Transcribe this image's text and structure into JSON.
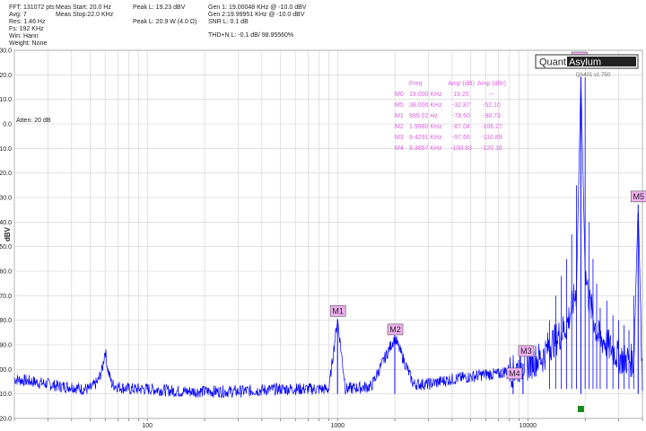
{
  "header": {
    "col1": [
      "FFT: 131072 pts",
      "Avg: 7",
      "Res: 1.46 Hz",
      "Fs: 192 KHz",
      "Win: Hann",
      "Weight: None"
    ],
    "col2": [
      "Meas Start: 20.0 Hz",
      "Meas Stop:22.0 KHz"
    ],
    "col3": [
      "Peak L: 19.23 dBV",
      "",
      "Peak L: 20.9 W (4.0 Ω)"
    ],
    "col4": [
      "Gen 1: 19.00048 KHz @ -10.0  dBV",
      "Gen 2:19.99951 KHz @ -10.0  dBV",
      "SNR L: 0.1 dB",
      "",
      "THD+N L: -0.1 dB/ 98.95560%"
    ]
  },
  "logo": {
    "part1": "Quant",
    "part2": "Asylum",
    "model": "QA401 v1.750"
  },
  "atten": "Atten: 20 dB",
  "marker_table": {
    "headers": [
      "Freq",
      "Amp (dB)",
      "Amp (dBr)"
    ],
    "rows": [
      [
        "M0",
        "19.000 KHz",
        "19.25",
        "---"
      ],
      [
        "M5",
        "38.000 KHz",
        "-32.87",
        "-52.10"
      ],
      [
        "M1",
        "999.02 Hz",
        "-79.50",
        "-98.73"
      ],
      [
        "M2",
        "1.9980 KHz",
        "-87.04",
        "-106.27"
      ],
      [
        "M3",
        "9.4291 KHz",
        "-97.66",
        "-116.89"
      ],
      [
        "M4",
        "8.3657 KHz",
        "-100.93",
        "-120.16"
      ]
    ]
  },
  "colors": {
    "trace": "#0000ff",
    "marker_fill": "#f0b0f0",
    "marker_text": "#e060e0",
    "gen_marker": "#1a8a1a",
    "grid": "#cfcfcf"
  },
  "chart_data": {
    "type": "line",
    "title": "",
    "xlabel": "",
    "ylabel": "dBV",
    "xscale": "log",
    "xlim": [
      20,
      40000
    ],
    "ylim": [
      -120,
      30
    ],
    "yticks": [
      30,
      20,
      10,
      0,
      -10,
      -20,
      -30,
      -40,
      -50,
      -60,
      -70,
      -80,
      -90,
      -100,
      -110,
      -120
    ],
    "ytick_labels": [
      "30.0",
      "20.0",
      "10.0",
      "0.0",
      "-10.0",
      "-20.0",
      "-30.0",
      "-40.0",
      "-50.0",
      "-60.0",
      "-70.0",
      "-80.0",
      "-90.0",
      "-100.0",
      "-110.0",
      "-120.0"
    ],
    "xticks": [
      100,
      1000,
      10000
    ],
    "xtick_labels": [
      "100",
      "1000",
      "10000"
    ],
    "grid": true,
    "series": [
      {
        "x": [
          20,
          25,
          30,
          35,
          40,
          45,
          50,
          55,
          58,
          60,
          62,
          65,
          70,
          80,
          100,
          150,
          200,
          300,
          500,
          700,
          900,
          999,
          1100,
          1500,
          1998,
          2500,
          3000,
          4000,
          5000,
          6000,
          7000,
          8000,
          8366,
          9000,
          9429,
          10000,
          11000,
          12000,
          13000,
          14000,
          15000,
          16000,
          17000,
          18000,
          19000,
          20000,
          21000,
          22000,
          23000,
          24000,
          25000,
          26000,
          28000,
          30000,
          32000,
          34000,
          36000,
          38000,
          40000
        ],
        "y": [
          -104,
          -105,
          -106,
          -107,
          -107,
          -108,
          -108,
          -105,
          -100,
          -92,
          -100,
          -106,
          -107,
          -108,
          -108,
          -109,
          -109,
          -109,
          -108,
          -108,
          -108,
          -79.5,
          -108,
          -107,
          -87,
          -106,
          -106,
          -104,
          -103,
          -102,
          -102,
          -100,
          -100.9,
          -99,
          -97.7,
          -98,
          -96,
          -95,
          -90,
          -88,
          -85,
          -82,
          -75,
          -68,
          19.25,
          -60,
          -72,
          -78,
          -85,
          -88,
          -88,
          -90,
          -92,
          -95,
          -96,
          -96,
          -97,
          -32.87,
          -105
        ]
      }
    ],
    "markers": [
      {
        "label": "M0",
        "freq": 19000,
        "amp": 19.25
      },
      {
        "label": "M1",
        "freq": 999.02,
        "amp": -79.5
      },
      {
        "label": "M2",
        "freq": 1998,
        "amp": -87.04
      },
      {
        "label": "M3",
        "freq": 9429.1,
        "amp": -97.66
      },
      {
        "label": "M4",
        "freq": 8365.7,
        "amp": -100.93
      },
      {
        "label": "M5",
        "freq": 38000,
        "amp": -32.87
      }
    ]
  }
}
